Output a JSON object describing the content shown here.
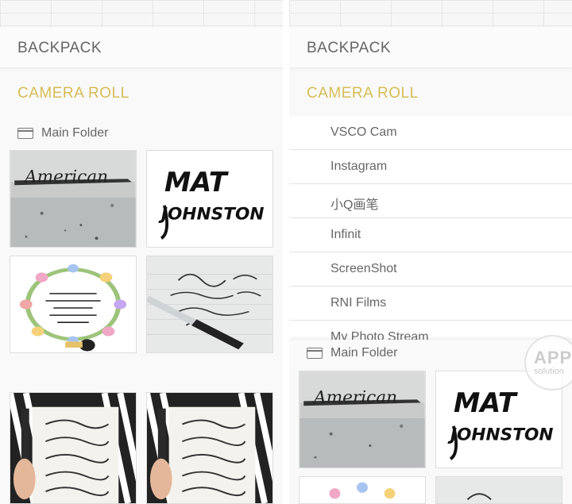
{
  "left_panel": {
    "backpack_label": "BACKPACK",
    "camera_roll_label": "CAMERA ROLL",
    "folder_label": "Main Folder",
    "thumbnails": [
      {
        "caption": "American"
      },
      {
        "caption": "MAT JOHNSTON"
      },
      {
        "caption": "Not for women / to break other women / perhaps / they may do better / than them"
      },
      {
        "caption": "Find what you Love and let it kill you"
      },
      {
        "caption": "buried beneath your worried weakness perhaps you'll find a pure uniqueness"
      },
      {
        "caption": "buried beneath your worried weakness perhaps you'll find a pure uniqueness"
      }
    ]
  },
  "right_panel": {
    "backpack_label": "BACKPACK",
    "camera_roll_label": "CAMERA ROLL",
    "albums": [
      "VSCO Cam",
      "Instagram",
      "小Q画笔",
      "Infinit",
      "ScreenShot",
      "RNI Films",
      "My Photo Stream"
    ],
    "folder_label": "Main Folder",
    "thumbnails": [
      {
        "caption": "American"
      },
      {
        "caption": "MAT JOHNSTON"
      }
    ]
  },
  "watermark": {
    "line1": "APP",
    "line2": "solution"
  },
  "colors": {
    "accent": "#d6bd54",
    "text": "#666666"
  }
}
